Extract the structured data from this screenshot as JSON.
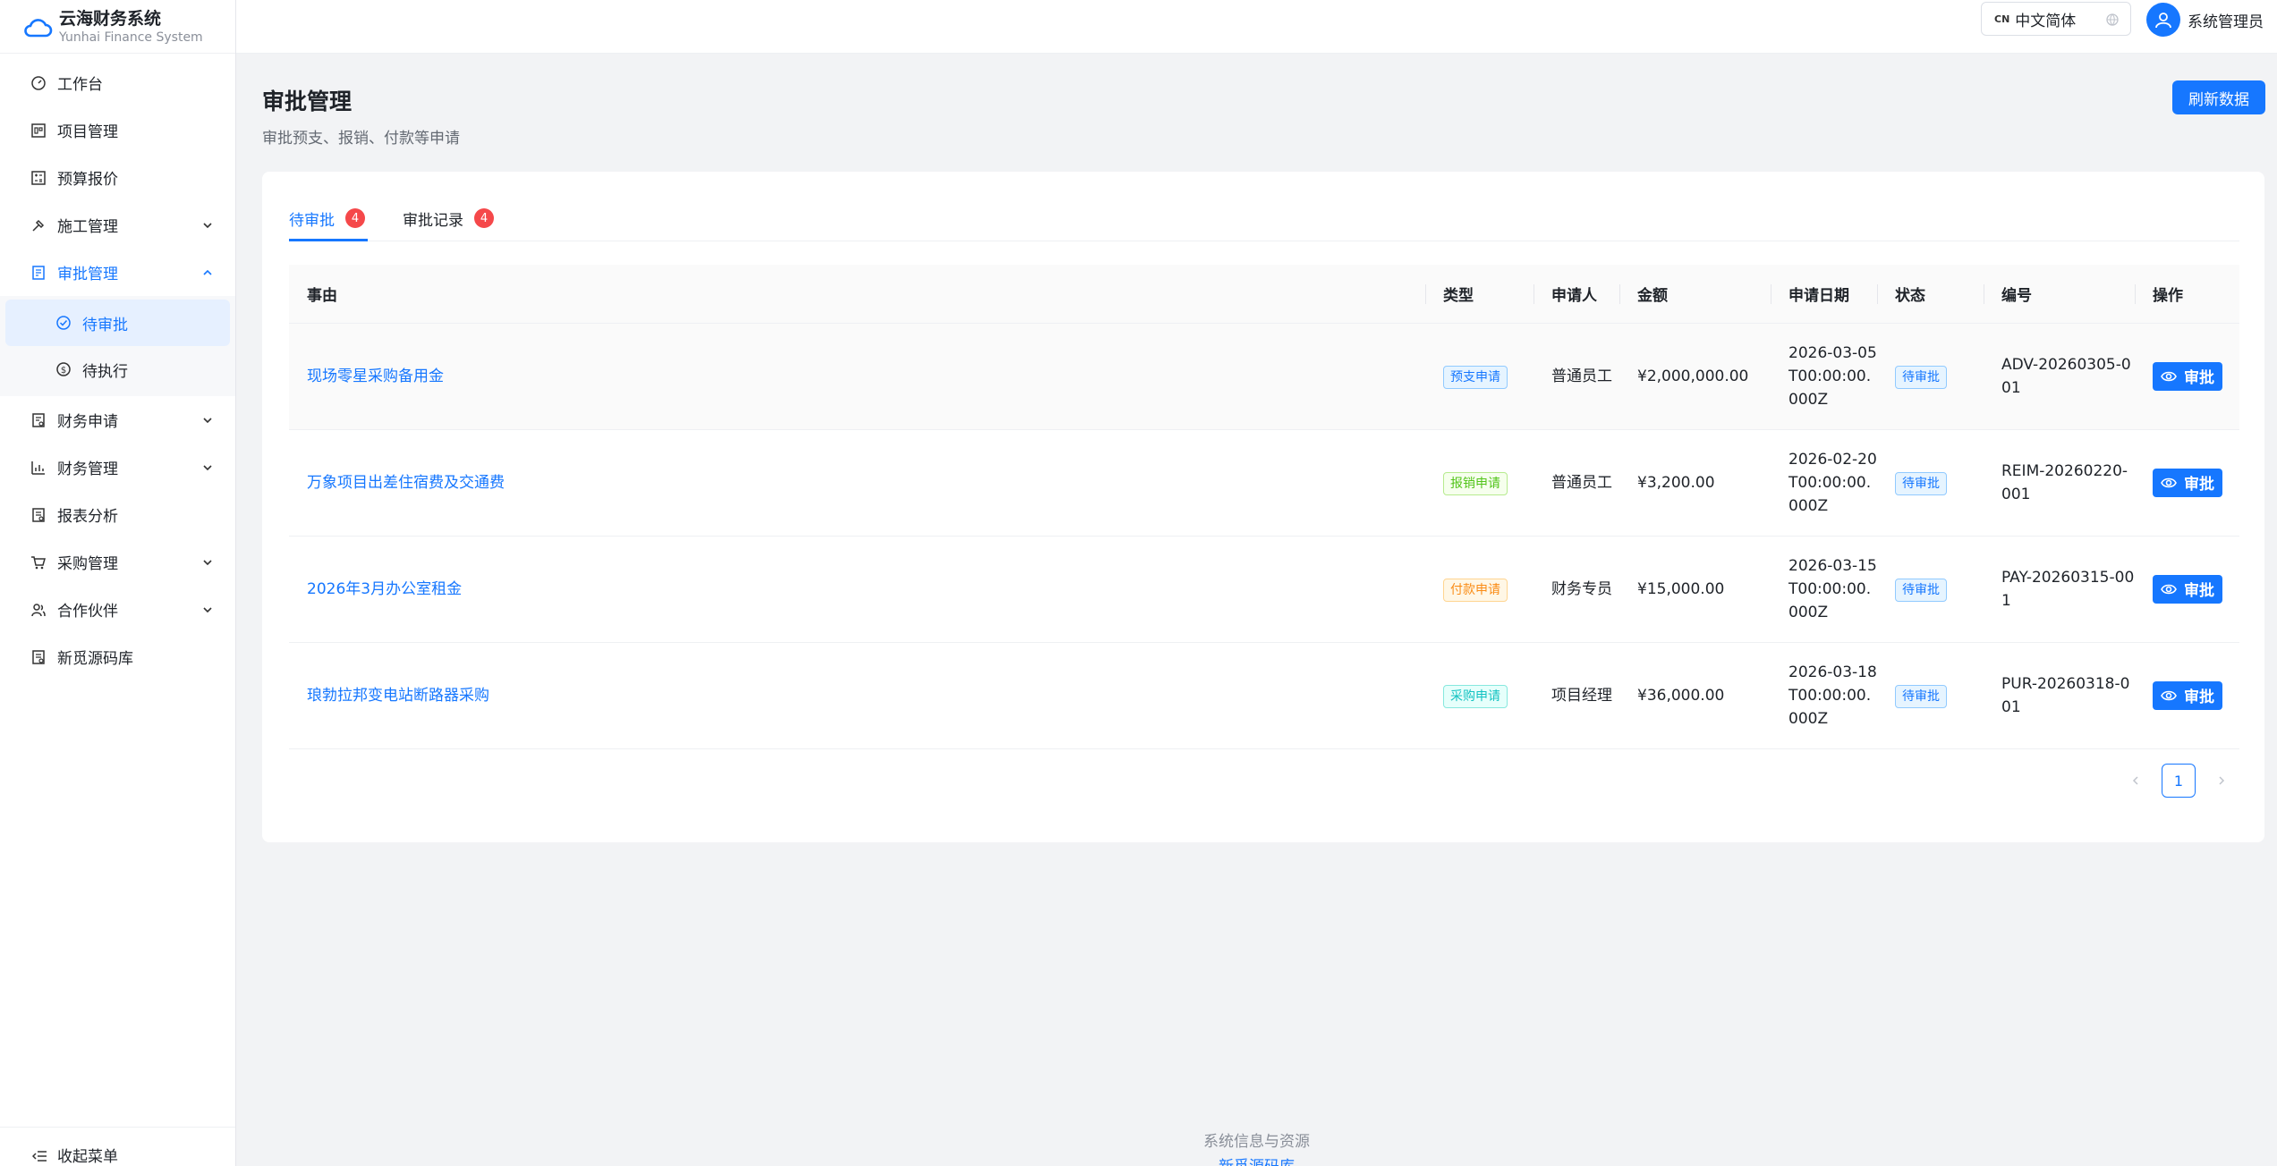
{
  "brand": {
    "title": "云海财务系统",
    "subtitle": "Yunhai Finance System"
  },
  "menu": {
    "workbench": "工作台",
    "projects": "项目管理",
    "budget": "预算报价",
    "construction": "施工管理",
    "approval": "审批管理",
    "pending": "待审批",
    "to_execute": "待执行",
    "finance_apply": "财务申请",
    "finance_manage": "财务管理",
    "reports": "报表分析",
    "purchase": "采购管理",
    "partners": "合作伙伴",
    "source_lib": "新觅源码库",
    "collapse": "收起菜单"
  },
  "header": {
    "lang_flag": "CN",
    "lang_label": "中文简体",
    "user_name": "系统管理员"
  },
  "page": {
    "title": "审批管理",
    "subtitle": "审批预支、报销、付款等申请",
    "refresh": "刷新数据"
  },
  "tabs": [
    {
      "label": "待审批",
      "count": "4"
    },
    {
      "label": "审批记录",
      "count": "4"
    }
  ],
  "table": {
    "columns": [
      "事由",
      "类型",
      "申请人",
      "金额",
      "申请日期",
      "状态",
      "编号",
      "操作"
    ],
    "rows": [
      {
        "reason": "现场零星采购备用金",
        "type": "预支申请",
        "applicant": "普通员工",
        "amount": "¥2,000,000.00",
        "date": "2026-03-05T00:00:00.000Z",
        "status": "待审批",
        "code": "ADV-20260305-001",
        "action": "审批"
      },
      {
        "reason": "万象项目出差住宿费及交通费",
        "type": "报销申请",
        "applicant": "普通员工",
        "amount": "¥3,200.00",
        "date": "2026-02-20T00:00:00.000Z",
        "status": "待审批",
        "code": "REIM-20260220-001",
        "action": "审批"
      },
      {
        "reason": "2026年3月办公室租金",
        "type": "付款申请",
        "applicant": "财务专员",
        "amount": "¥15,000.00",
        "date": "2026-03-15T00:00:00.000Z",
        "status": "待审批",
        "code": "PAY-20260315-001",
        "action": "审批"
      },
      {
        "reason": "琅勃拉邦变电站断路器采购",
        "type": "采购申请",
        "applicant": "项目经理",
        "amount": "¥36,000.00",
        "date": "2026-03-18T00:00:00.000Z",
        "status": "待审批",
        "code": "PUR-20260318-001",
        "action": "审批"
      }
    ]
  },
  "pagination": {
    "current": "1"
  },
  "footer": {
    "info": "系统信息与资源",
    "link": "新觅源码库"
  },
  "colors": {
    "primary": "#1677ff",
    "badge": "#f5484a"
  }
}
